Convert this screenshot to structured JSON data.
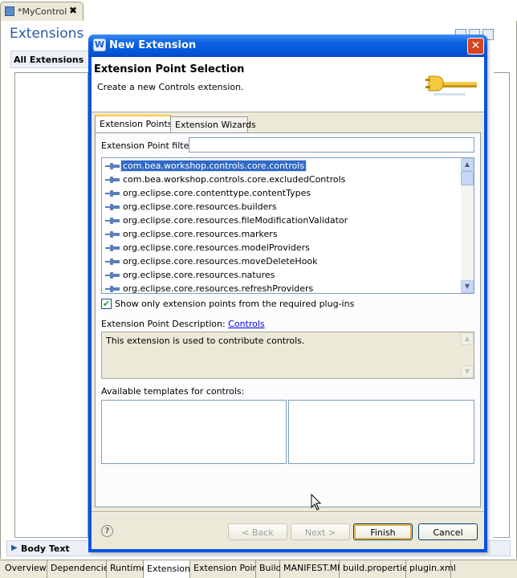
{
  "editor": {
    "tab_title": "*MyControl",
    "tab_close": "✖",
    "title": "Extensions",
    "all_extensions_section": "All Extensions",
    "body_text_section": "Body Text",
    "body_text_twisty": "▶",
    "page_tabs": [
      "Overview",
      "Dependencies",
      "Runtime",
      "Extensions",
      "Extension Points",
      "Build",
      "MANIFEST.MF",
      "build.properties",
      "plugin.xml"
    ],
    "active_page_tab": "Extensions"
  },
  "dialog": {
    "title": "New Extension",
    "title_icon": "W",
    "close_glyph": "✕",
    "banner_title": "Extension Point Selection",
    "banner_subtitle": "Create a new Controls extension.",
    "tabs": [
      "Extension Points",
      "Extension Wizards"
    ],
    "active_tab": "Extension Points",
    "filter": {
      "label": "Extension Point filter:",
      "value": "",
      "placeholder": ""
    },
    "extension_points": [
      "com.bea.workshop.controls.core.controls",
      "com.bea.workshop.controls.core.excludedControls",
      "org.eclipse.core.contenttype.contentTypes",
      "org.eclipse.core.resources.builders",
      "org.eclipse.core.resources.fileModificationValidator",
      "org.eclipse.core.resources.markers",
      "org.eclipse.core.resources.modelProviders",
      "org.eclipse.core.resources.moveDeleteHook",
      "org.eclipse.core.resources.natures",
      "org.eclipse.core.resources.refreshProviders"
    ],
    "selected_index": 0,
    "show_only_checked": true,
    "show_only_label": "Show only extension points from the required plug-ins",
    "description_label": "Extension Point Description:",
    "description_link": "Controls",
    "description_text": "This extension is used to contribute controls.",
    "templates_label": "Available templates for controls:",
    "help_glyph": "?",
    "buttons": {
      "back": "< Back",
      "next": "Next >",
      "finish": "Finish",
      "cancel": "Cancel"
    }
  },
  "colors": {
    "titlebar": "#0054e3",
    "selection": "#316ac5",
    "link": "#0000ee",
    "editor_title": "#2b5aa6",
    "plug_icon": "#5a7fba"
  }
}
